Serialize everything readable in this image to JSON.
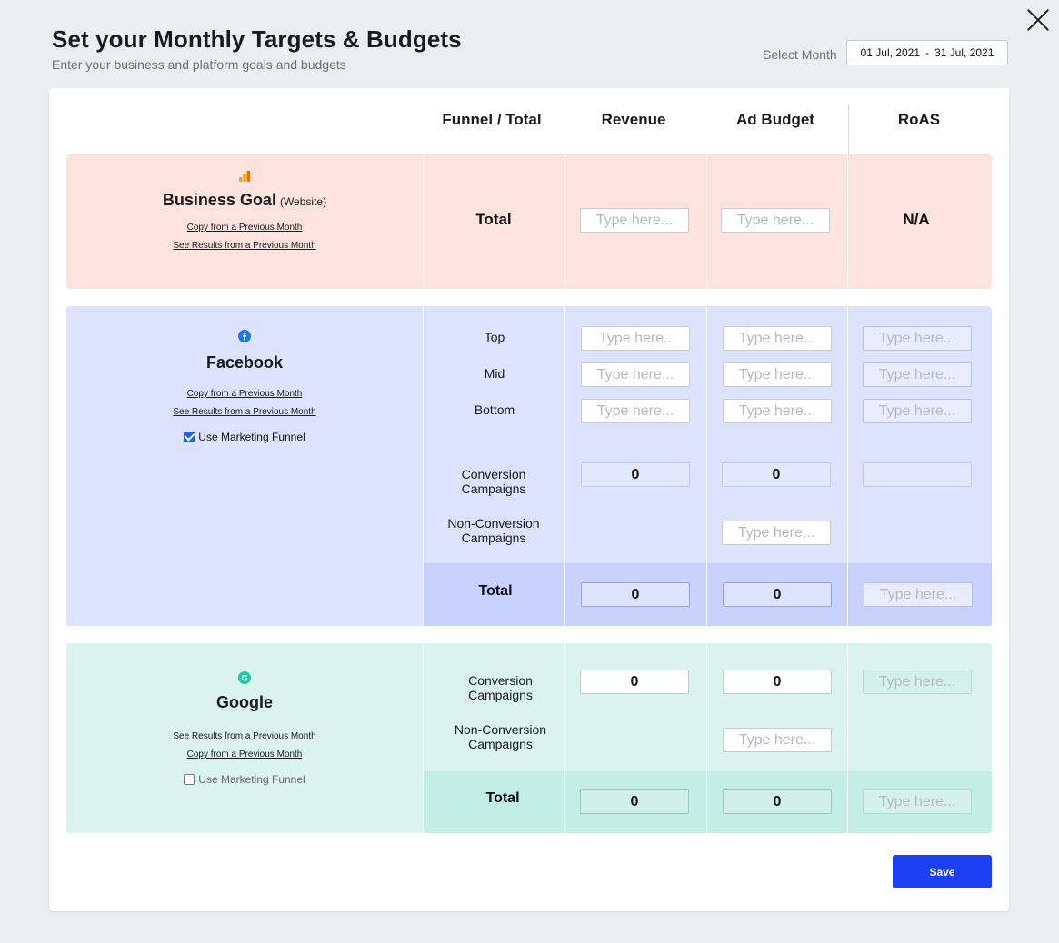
{
  "header": {
    "title": "Set your Monthly Targets & Budgets",
    "subtitle": "Enter your business and platform goals and budgets",
    "month_label": "Select Month",
    "month_start": "01 Jul, 2021",
    "month_sep": "-",
    "month_end": "31 Jul, 2021"
  },
  "columns": {
    "funnel": "Funnel / Total",
    "revenue": "Revenue",
    "ad_budget": "Ad Budget",
    "roas": "RoAS"
  },
  "business": {
    "title": "Business Goal",
    "suffix": "(Website)",
    "copy_link": "Copy from a Previous Month",
    "results_link": "See Results from a Previous Month",
    "total_label": "Total",
    "revenue_placeholder": "Type here...",
    "budget_placeholder": "Type here...",
    "roas_value": "N/A"
  },
  "facebook": {
    "title": "Facebook",
    "copy_link": "Copy from a Previous Month",
    "results_link": "See Results  from a Previous Month",
    "funnel_label": "Use Marketing Funnel",
    "funnel_checked": true,
    "rows": {
      "top": {
        "label": "Top",
        "revenue_ph": "Type here..",
        "budget_ph": "Type here...",
        "roas_ph": "Type here..."
      },
      "mid": {
        "label": "Mid",
        "revenue_ph": "Type here...",
        "budget_ph": "Type here...",
        "roas_ph": "Type here..."
      },
      "bottom": {
        "label": "Bottom",
        "revenue_ph": "Type here...",
        "budget_ph": "Type here...",
        "roas_ph": "Type here..."
      }
    },
    "conversion_label_1": "Conversion",
    "conversion_label_2": "Campaigns",
    "conversion_revenue": "0",
    "conversion_budget": "0",
    "nonconversion_label_1": "Non-Conversion",
    "nonconversion_label_2": "Campaigns",
    "nonconversion_budget_ph": "Type here...",
    "total_label": "Total",
    "total_revenue": "0",
    "total_budget": "0",
    "total_roas_ph": "Type here..."
  },
  "google": {
    "title": "Google",
    "results_link": "See Results  from a Previous Month",
    "copy_link": "Copy from a Previous Month",
    "funnel_label": "Use Marketing Funnel",
    "funnel_checked": false,
    "conversion_label_1": "Conversion",
    "conversion_label_2": "Campaigns",
    "conversion_revenue": "0",
    "conversion_budget": "0",
    "conversion_roas_ph": "Type here...",
    "nonconversion_label_1": "Non-Conversion",
    "nonconversion_label_2": "Campaigns",
    "nonconversion_budget_ph": "Type here...",
    "total_label": "Total",
    "total_revenue": "0",
    "total_budget": "0",
    "total_roas_ph": "Type here..."
  },
  "actions": {
    "save_label": "Save"
  },
  "colors": {
    "accent": "#1d40f5",
    "business_bg": "#fde3de",
    "facebook_bg": "#dde3fd",
    "google_bg": "#daf3ef"
  },
  "icons": {
    "close": "close-icon",
    "analytics": "analytics-icon",
    "facebook": "facebook-icon",
    "google": "google-icon"
  }
}
